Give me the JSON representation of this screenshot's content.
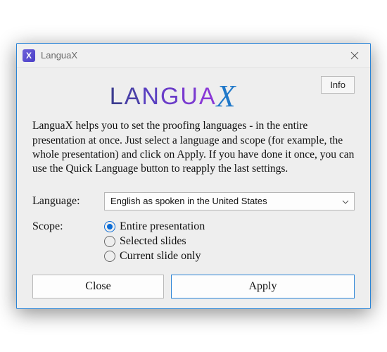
{
  "titlebar": {
    "app_name": "LanguaX"
  },
  "header": {
    "logo_text": "LANGUAX",
    "info_button": "Info"
  },
  "description": "LanguaX helps you to set the proofing languages - in the entire presentation at once. Just select a language and scope (for example, the whole presentation) and click on Apply. If you have done it once, you can use the Quick Language button to reapply the last settings.",
  "form": {
    "language_label": "Language:",
    "language_value": "English as spoken in the United States",
    "scope_label": "Scope:",
    "scope_options": [
      {
        "label": "Entire presentation",
        "selected": true
      },
      {
        "label": "Selected slides",
        "selected": false
      },
      {
        "label": "Current slide only",
        "selected": false
      }
    ]
  },
  "footer": {
    "close": "Close",
    "apply": "Apply"
  }
}
